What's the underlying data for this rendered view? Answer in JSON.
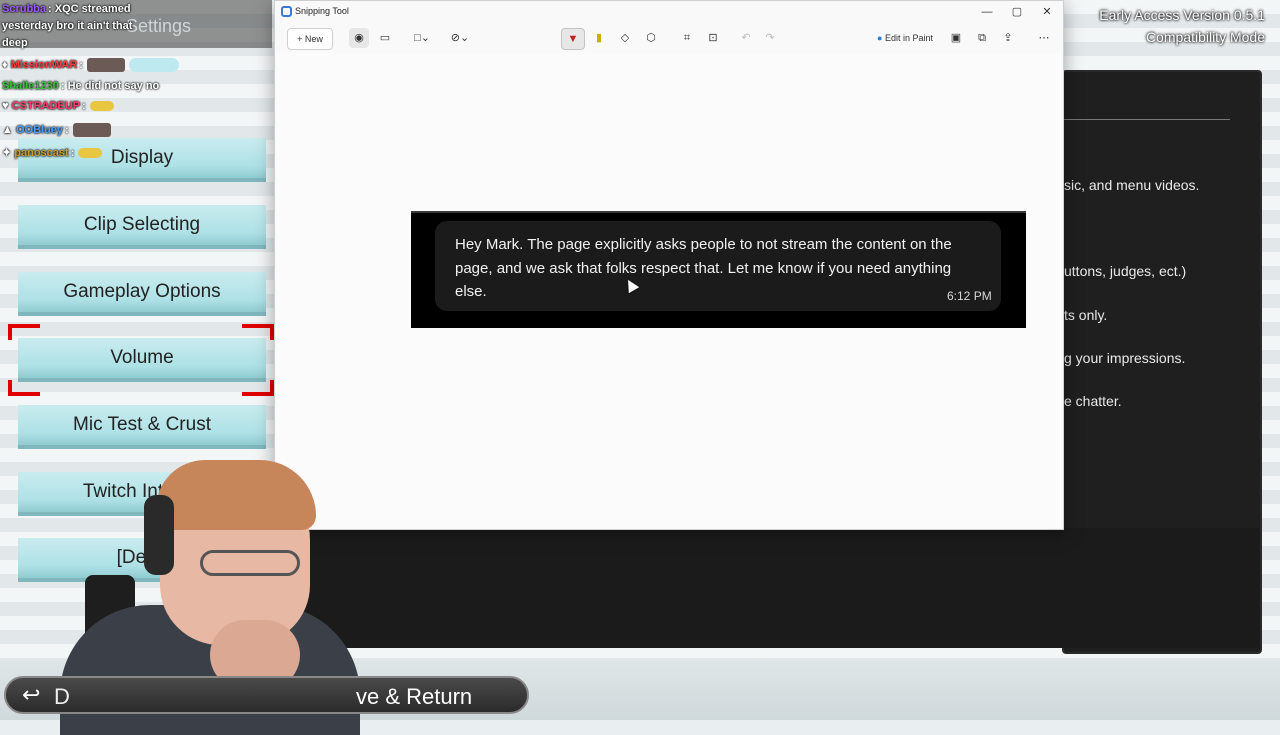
{
  "game": {
    "version_line1": "Early Access Version 0.5.1",
    "version_line2": "Compatibility Mode",
    "header_ghost": "Settings",
    "menu": [
      {
        "label": "Display"
      },
      {
        "label": "Clip Selecting"
      },
      {
        "label": "Gameplay Options"
      },
      {
        "label": "Volume"
      },
      {
        "label": "Mic Test & Crust"
      },
      {
        "label": "Twitch Integra"
      },
      {
        "label": "[Debu"
      }
    ],
    "panel_fragments": [
      "sic, and menu videos.",
      "uttons, judges, ect.)",
      "ts only.",
      "g your impressions.",
      "e chatter."
    ],
    "bottom": {
      "back_fragment": "D",
      "save_label": "ve & Return"
    }
  },
  "chat": [
    {
      "user": "Scrubba",
      "text": ": XQC streamed",
      "color": "#9b59ff"
    },
    {
      "user": "",
      "text": "yesterday bro it ain't that",
      "color": "#ffffff"
    },
    {
      "user": "",
      "text": "deep",
      "color": "#ffffff"
    },
    {
      "user": "MissionWAR",
      "text": ":",
      "color": "#ff3b3b"
    },
    {
      "user": "Shalle1230",
      "text": ": He did not say no",
      "color": "#38c43a"
    },
    {
      "user": "CSTRADEUP",
      "text": ":",
      "color": "#ff3b6b"
    },
    {
      "user": "OOBluey",
      "text": ":",
      "color": "#4aa0ff"
    },
    {
      "user": "panoscast",
      "text": ":",
      "color": "#c99a2e"
    }
  ],
  "snipping_tool": {
    "title": "Snipping Tool",
    "new_label": "New",
    "edit_in_paint": "Edit in Paint",
    "message": "Hey Mark. The page explicitly asks people to not stream the content on the page, and we ask that folks respect that. Let me know if you need anything else.",
    "time": "6:12 PM"
  },
  "colors": {
    "accent_red": "#e00000",
    "menu_button": "#aee1e6",
    "snip_bg": "#f9f9f9"
  }
}
